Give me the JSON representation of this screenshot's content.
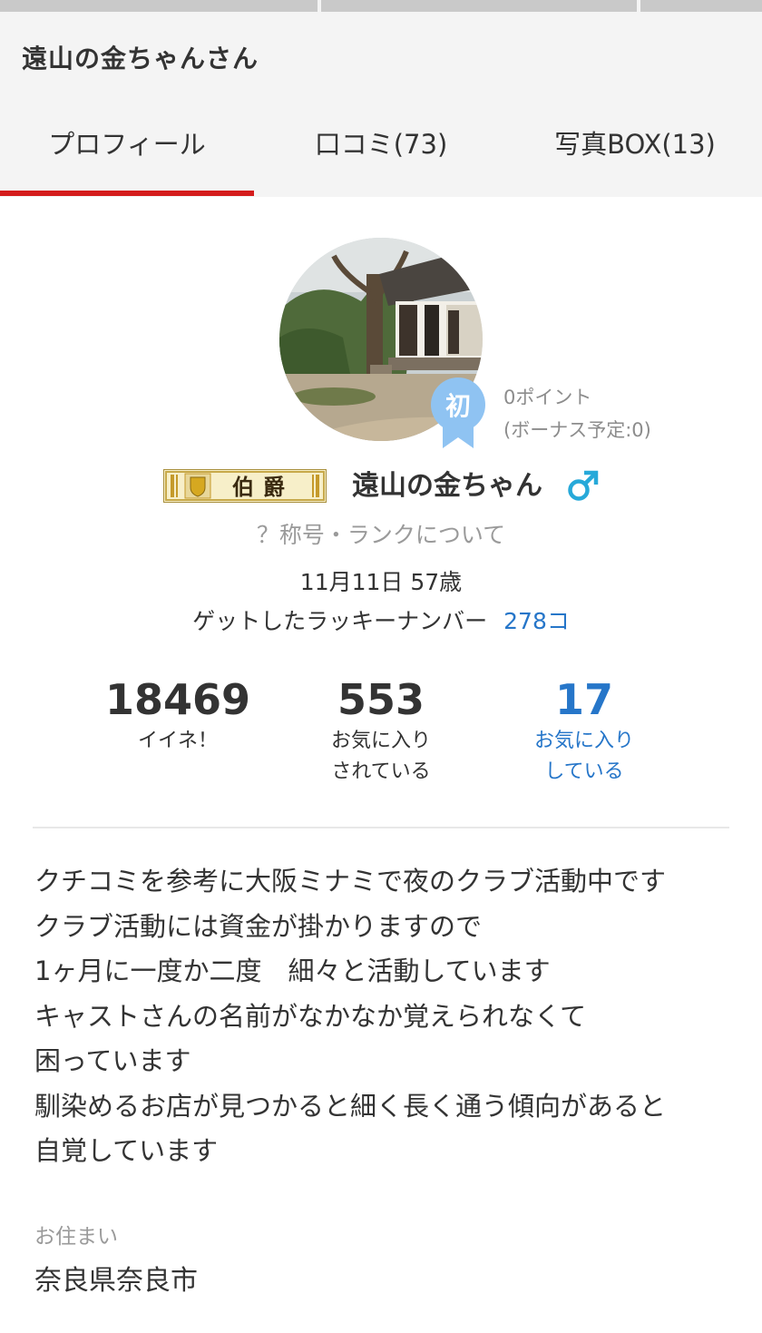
{
  "header": {
    "title": "遠山の金ちゃんさん"
  },
  "tabs": [
    {
      "label": "プロフィール"
    },
    {
      "label": "口コミ(73)"
    },
    {
      "label": "写真BOX(13)"
    }
  ],
  "profile": {
    "badge_char": "初",
    "points": "0ポイント",
    "bonus": "(ボーナス予定:0)",
    "rank_badge": "伯爵",
    "username": "遠山の金ちゃん",
    "rank_link": "？称号・ランクについて",
    "birthday": "11月11日 57歳",
    "lucky_label": "ゲットしたラッキーナンバー",
    "lucky_value": "278コ"
  },
  "stats": [
    {
      "value": "18469",
      "label_line1": "イイネ！",
      "label_line2": ""
    },
    {
      "value": "553",
      "label_line1": "お気に入り",
      "label_line2": "されている"
    },
    {
      "value": "17",
      "label_line1": "お気に入り",
      "label_line2": "している"
    }
  ],
  "bio": [
    "クチコミを参考に大阪ミナミで夜のクラブ活動中です",
    "クラブ活動には資金が掛かりますので",
    "1ヶ月に一度か二度　細々と活動しています",
    "キャストさんの名前がなかなか覚えられなくて",
    "困っています",
    "馴染めるお店が見つかると細く長く通う傾向があると",
    "自覚しています"
  ],
  "residence": {
    "label": "お住まい",
    "value": "奈良県奈良市"
  },
  "colors": {
    "accent_red": "#d41c1c",
    "link_blue": "#2676c9",
    "gender_blue": "#27a9d9",
    "badge_blue": "#8fc3f2"
  },
  "icons": {
    "gender": "male-symbol-icon",
    "badge": "ribbon-badge-icon",
    "rank": "shield-icon"
  }
}
